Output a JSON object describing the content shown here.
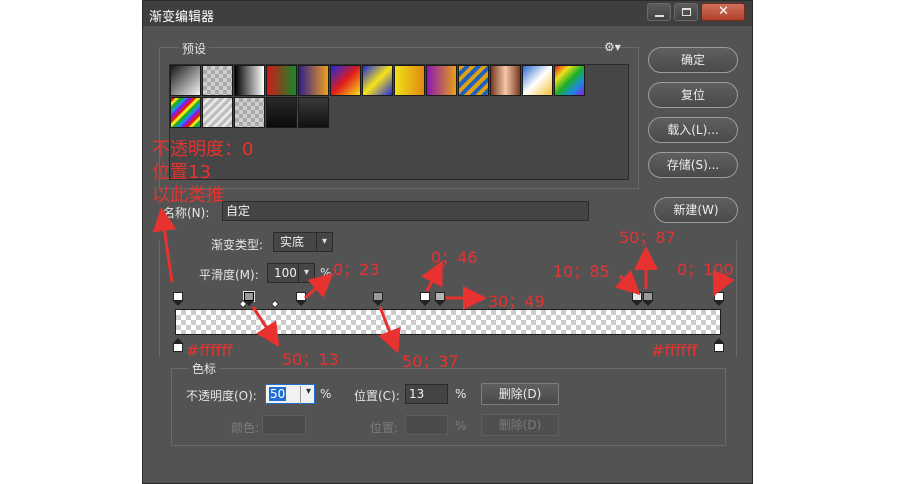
{
  "window": {
    "title": "渐变编辑器",
    "close_glyph": "✕"
  },
  "presets": {
    "legend": "预设",
    "settings_icon": "gear-icon",
    "settings_glyph": "⚙▾"
  },
  "buttons": {
    "ok": "确定",
    "reset": "复位",
    "load": "载入(L)...",
    "save": "存储(S)...",
    "new": "新建(W)"
  },
  "name": {
    "label": "名称(N):",
    "value": "自定"
  },
  "gradient": {
    "type_label": "渐变类型:",
    "type_value": "实底",
    "smooth_label": "平滑度(M):",
    "smooth_value": "100",
    "smooth_unit": "%"
  },
  "stops_panel": {
    "legend": "色标",
    "opacity_label": "不透明度(O):",
    "opacity_value": "50",
    "opacity_unit": "%",
    "location_label": "位置(C):",
    "location_value": "13",
    "location_unit": "%",
    "delete_label": "删除(D)",
    "color_label": "颜色:",
    "color_location_label": "位置:",
    "color_location_unit": "%",
    "color_delete_label": "删除(D)"
  },
  "annotations": {
    "note_opacity": "不透明度：0",
    "note_position": "位置13",
    "note_etc": "以此类推",
    "s_0_23": "0；23",
    "s_0_46": "0；46",
    "s_30_49": "30；49",
    "s_50_87": "50；87",
    "s_10_85": "10；85",
    "s_0_100": "0；100",
    "s_50_13": "50；13",
    "s_50_37": "50；37",
    "color_left": "#ffffff",
    "color_right": "#ffffff"
  },
  "colors": {
    "dialog_bg": "#535353",
    "annotation_red": "#e8322f",
    "focus_blue": "#1e6fd0"
  }
}
